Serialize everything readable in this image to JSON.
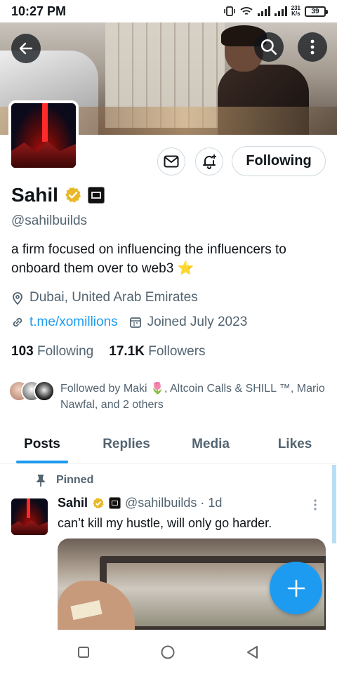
{
  "status_bar": {
    "time": "10:27 PM",
    "net_speed_value": "231",
    "net_speed_unit": "K/s",
    "battery": "39"
  },
  "profile": {
    "name": "Sahil",
    "handle": "@sahilbuilds",
    "bio": "a firm focused on influencing the influencers to onboard them over to web3 ⭐",
    "location": "Dubai, United Arab Emirates",
    "link": "t.me/xomillions",
    "joined": "Joined July 2023",
    "following_count": "103",
    "following_label": "Following",
    "followers_count": "17.1K",
    "followers_label": "Followers",
    "followed_by": "Followed by Maki 🌷, Altcoin Calls & SHILL ™, Mario Nawfal, and 2 others",
    "follow_button": "Following"
  },
  "tabs": [
    {
      "label": "Posts",
      "active": true
    },
    {
      "label": "Replies",
      "active": false
    },
    {
      "label": "Media",
      "active": false
    },
    {
      "label": "Likes",
      "active": false
    }
  ],
  "post": {
    "pinned_label": "Pinned",
    "author": "Sahil",
    "handle_time": "@sahilbuilds · 1d",
    "text": "can’t kill my hustle, will only go harder."
  },
  "colors": {
    "accent": "#1d9bf0",
    "verified": "#e8b829",
    "muted": "#536471"
  },
  "icons": [
    "back-arrow-icon",
    "search-icon",
    "more-vertical-icon",
    "mail-icon",
    "bell-plus-icon",
    "location-pin-icon",
    "link-icon",
    "calendar-icon",
    "pin-icon",
    "compose-plus-icon"
  ]
}
